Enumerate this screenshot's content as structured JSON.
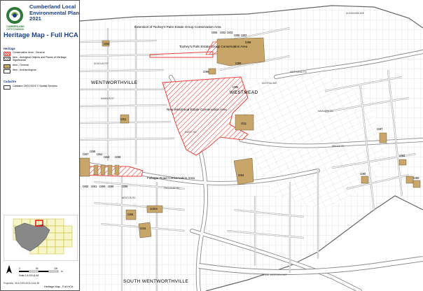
{
  "legend": {
    "council_name": "CUMBERLAND CITY COUNCIL",
    "plan_title": "Cumberland Local Environmental Plan 2021",
    "map_title": "Heritage Map - Full HCA",
    "heritage_heading": "Heritage",
    "items": [
      {
        "label": "Conservation Area - General",
        "swatch": "hca"
      },
      {
        "label": "Item - Aboriginal Objects and Places of Heritage Significance",
        "swatch": "aboriginal"
      },
      {
        "label": "Item - General",
        "swatch": "general"
      },
      {
        "label": "Item - Archaeological",
        "swatch": "archaeological"
      }
    ],
    "cadastre_heading": "Cadastre",
    "cadastre_item": "Cadastre 29/07/2021 © Spatial Services",
    "scale_text": "Scale 1:5,000 @ A4",
    "scale_ticks": [
      "0",
      "50",
      "100",
      "m"
    ],
    "projection_text": "Projection: GDA 1994 MGA Zone 56",
    "sheet_label": "Heritage Map - Full HCA"
  },
  "colors": {
    "hca_hatch": "#e8413a",
    "item_general": "#c8a569",
    "title_blue": "#1b3f8b",
    "logo_green": "#2d7a3a",
    "road_border": "#8c8c8c"
  },
  "map": {
    "suburbs": [
      "WENTWORTHVILLE",
      "WESTMEAD",
      "SOUTH WENTWORTHVILLE"
    ],
    "conservation_areas": [
      "Extension of Toohey's Palm Estate Group Conservation Area",
      "Toohey's Palm Estate Group Conservation Area",
      "New Westmead Estate Conservation Area",
      "Fullagar Road Conservation Area"
    ],
    "item_labels": [
      "I254",
      "I306",
      "I302",
      "I303",
      "I305",
      "I307",
      "I298",
      "I299",
      "I295",
      "I300",
      "I296",
      "I286",
      "I311",
      "I251",
      "I294",
      "I267",
      "I268",
      "I264",
      "I263",
      "I259",
      "I257",
      "I262",
      "I261",
      "I260",
      "I255",
      "I258",
      "I256",
      "I2204",
      "I244",
      "I256",
      "I287",
      "I282",
      "I291",
      "I292",
      "I290",
      "I280",
      "I252"
    ],
    "streets": [
      "DOUGLAS ST",
      "MANSON ST",
      "FULLAGAR RD",
      "GREAT WESTERN HWY",
      "BRIDGE RD",
      "WESTMEAD RD",
      "DARCY RD",
      "AUSTRAL AVE",
      "NEWTON RD",
      "HAMMERS RD",
      "ALEXANDRA AVE",
      "BRIDGETOWN ST",
      "DRAFTON ST"
    ]
  }
}
